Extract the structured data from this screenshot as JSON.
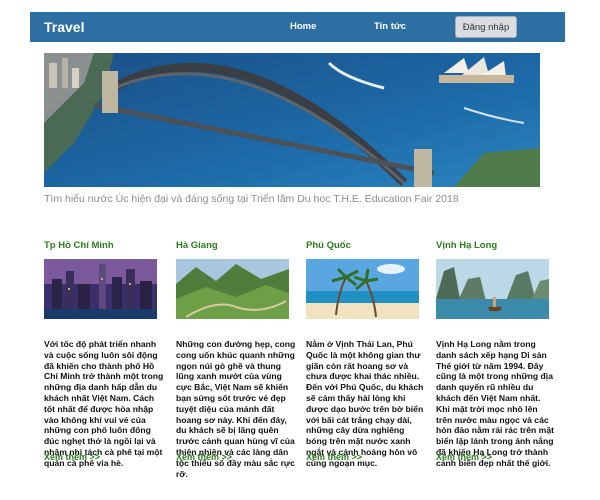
{
  "navbar": {
    "brand": "Travel",
    "links": [
      {
        "label": "Home"
      },
      {
        "label": "Tin tức"
      }
    ],
    "login_label": "Đăng nhập"
  },
  "hero": {
    "image_subject": "Sydney Harbour Bridge and Opera House aerial view",
    "caption": "Tìm hiểu nước Úc hiện đại và đáng sống tại Triển lãm Du học T.H.E. Education Fair 2018"
  },
  "destinations": [
    {
      "title": "Tp Hồ Chí Minh",
      "image_subject": "city skyline at dusk",
      "text": "Với tốc độ phát triển nhanh và cuộc sống luôn sôi động đã khiến cho thành phố Hồ Chí Minh trở thành một trong những địa danh hấp dẫn du khách nhất Việt Nam. Cách tốt nhất để được hòa nhập vào không khí vui vẻ của những con phố luôn đông đúc nghẹt thở là ngồi lại và nhâm nhi tách cà phê tại một quán cà phê vỉa hè.",
      "more": "Xem thêm >>"
    },
    {
      "title": "Hà Giang",
      "image_subject": "green mountain valley with winding road",
      "text": "Những con đường hẹp, cong cong uốn khúc quanh những ngọn núi gò ghề và thung lũng xanh mướt của vùng cực Bắc, Việt Nam sẽ khiến bạn sửng sốt trước vẻ đẹp tuyệt diệu của mảnh đất hoang sơ này. Khi đến đây, du khách sẽ bị lãng quên trước cảnh quan hùng vĩ của thiên nhiên và các làng dân tộc thiểu số đầy màu sắc rực rỡ.",
      "more": "Xem thêm >>"
    },
    {
      "title": "Phú Quốc",
      "image_subject": "tropical beach with palm trees",
      "text": "Nằm ở Vịnh Thái Lan, Phú Quốc là một không gian thư giãn còn rất hoang sơ và chưa được khai thác nhiều. Đến với Phú Quốc, du khách sẽ cảm thấy hài lòng khi được dạo bước trên bờ biển với bãi cát trắng chạy dài, những cây dừa nghiêng bóng trên mặt nước xanh ngắt và cảnh hoàng hôn vô cùng ngoạn mục.",
      "more": "Xem thêm >>"
    },
    {
      "title": "Vịnh Hạ Long",
      "image_subject": "limestone karsts and boat in bay",
      "text": "Vịnh Hạ Long nằm trong danh sách xếp hạng Di sản Thế giới từ năm 1994. Đây cũng là một trong những địa danh quyến rũ nhiều du khách đến Việt Nam nhất. Khi mặt trời mọc nhô lên trên nước màu ngọc và các hòn đảo nằm rải rác trên mặt biển lặp lánh trong ánh nắng đã khiến Hạ Long trở thành cảnh biển đẹp nhất thế giới.",
      "more": "Xem thêm >>"
    }
  ],
  "colors": {
    "navbar": "#2d6ea3",
    "accent_green": "#2d7d1f",
    "caption_gray": "#8d8d8d"
  }
}
